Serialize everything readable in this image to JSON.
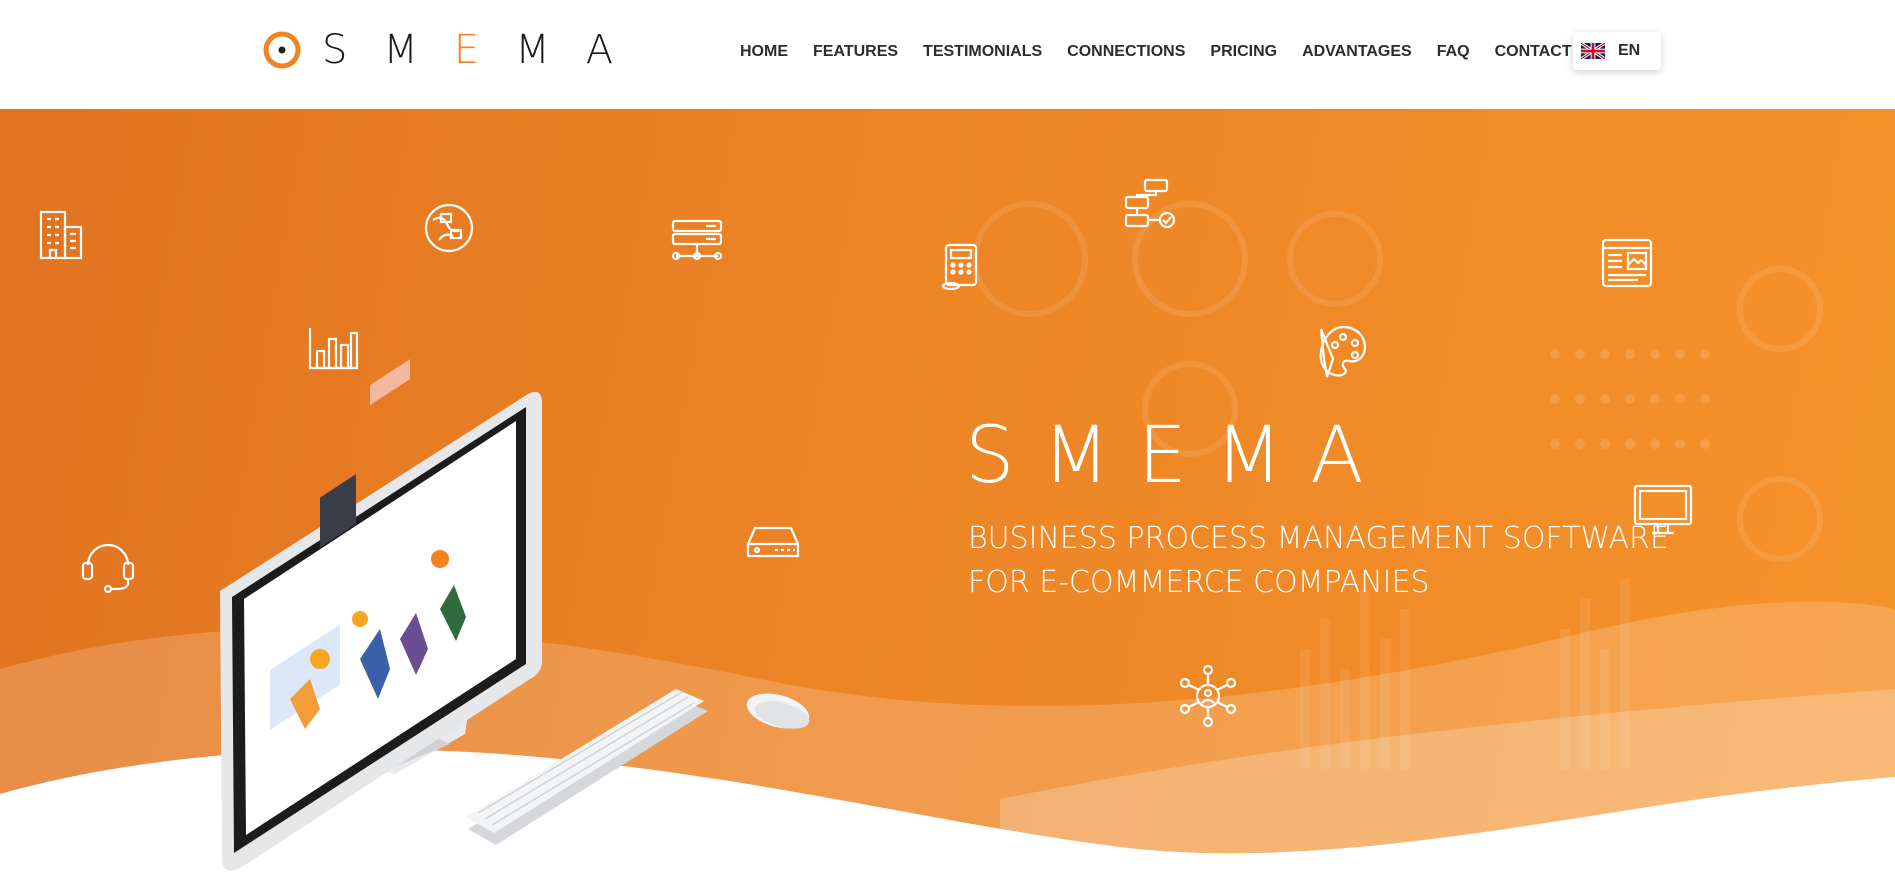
{
  "header": {
    "logo": {
      "name": "SMEMA",
      "text_parts": [
        "SM",
        "E",
        "MA"
      ],
      "mark_icon": "circle-target-icon",
      "accent_color": "#f58220"
    },
    "nav": [
      {
        "label": "HOME"
      },
      {
        "label": "FEATURES"
      },
      {
        "label": "TESTIMONIALS"
      },
      {
        "label": "CONNECTIONS"
      },
      {
        "label": "PRICING"
      },
      {
        "label": "ADVANTAGES"
      },
      {
        "label": "FAQ"
      },
      {
        "label": "CONTACT"
      }
    ],
    "language": {
      "label": "EN",
      "flag_icon": "uk-flag-icon"
    }
  },
  "hero": {
    "title": "SMEMA",
    "subtitle_line1": "BUSINESS PROCESS MANAGEMENT SOFTWARE",
    "subtitle_line2": "FOR E-COMMERCE COMPANIES",
    "background_color": "#ec8426",
    "floating_icons": [
      "building-icon",
      "globe-network-icon",
      "server-network-icon",
      "calculator-icon",
      "flowchart-icon",
      "web-layout-icon",
      "bar-chart-icon",
      "palette-icon",
      "headset-icon",
      "hard-drive-icon",
      "monitor-icon",
      "network-hub-icon"
    ]
  }
}
